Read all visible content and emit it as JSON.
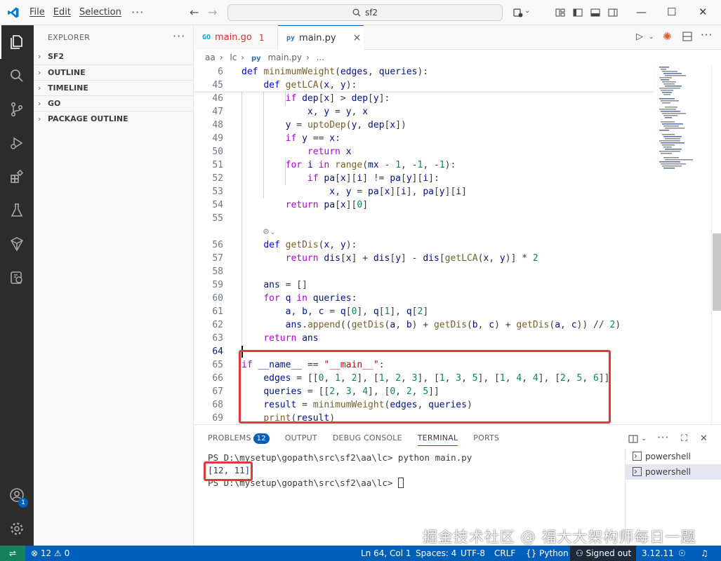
{
  "titlebar": {
    "menu": [
      "File",
      "Edit",
      "Selection"
    ],
    "more": "···",
    "search_text": "sf2"
  },
  "sidebar": {
    "title": "EXPLORER",
    "more": "···",
    "sections": [
      "SF2",
      "OUTLINE",
      "TIMELINE",
      "GO",
      "PACKAGE OUTLINE"
    ]
  },
  "tabs": [
    {
      "label": "main.go",
      "icon": "GO",
      "problems": "1"
    },
    {
      "label": "main.py",
      "icon": "py",
      "close": "×"
    }
  ],
  "breadcrumb": [
    "aa",
    "lc",
    "main.py"
  ],
  "editor": {
    "sticky": [
      {
        "num": "6",
        "tokens": [
          [
            "kw",
            "def "
          ],
          [
            "fn",
            "minimumWeight"
          ],
          [
            "",
            "("
          ],
          [
            "var",
            "edges"
          ],
          [
            "",
            ", "
          ],
          [
            "var",
            "queries"
          ],
          [
            "",
            "):"
          ]
        ]
      },
      {
        "num": "45",
        "tokens": [
          [
            "",
            "    "
          ],
          [
            "kw",
            "def "
          ],
          [
            "fn",
            "getLCA"
          ],
          [
            "",
            "("
          ],
          [
            "var",
            "x"
          ],
          [
            "",
            ", "
          ],
          [
            "var",
            "y"
          ],
          [
            "",
            "):"
          ]
        ]
      }
    ],
    "lines": [
      {
        "num": "46",
        "tokens": [
          [
            "",
            "        "
          ],
          [
            "kw2",
            "if "
          ],
          [
            "var",
            "dep"
          ],
          [
            "",
            "["
          ],
          [
            "var",
            "x"
          ],
          [
            "",
            "] > "
          ],
          [
            "var",
            "dep"
          ],
          [
            "",
            "["
          ],
          [
            "var",
            "y"
          ],
          [
            "",
            "]:"
          ]
        ]
      },
      {
        "num": "47",
        "tokens": [
          [
            "",
            "            "
          ],
          [
            "var",
            "x"
          ],
          [
            "",
            ", "
          ],
          [
            "var",
            "y"
          ],
          [
            "",
            " = "
          ],
          [
            "var",
            "y"
          ],
          [
            "",
            ", "
          ],
          [
            "var",
            "x"
          ]
        ]
      },
      {
        "num": "48",
        "tokens": [
          [
            "",
            "        "
          ],
          [
            "var",
            "y"
          ],
          [
            "",
            " = "
          ],
          [
            "fn",
            "uptoDep"
          ],
          [
            "",
            "("
          ],
          [
            "var",
            "y"
          ],
          [
            "",
            ", "
          ],
          [
            "var",
            "dep"
          ],
          [
            "",
            "["
          ],
          [
            "var",
            "x"
          ],
          [
            "",
            "])"
          ]
        ]
      },
      {
        "num": "49",
        "tokens": [
          [
            "",
            "        "
          ],
          [
            "kw2",
            "if "
          ],
          [
            "var",
            "y"
          ],
          [
            "",
            " == "
          ],
          [
            "var",
            "x"
          ],
          [
            "",
            ":"
          ]
        ]
      },
      {
        "num": "50",
        "tokens": [
          [
            "",
            "            "
          ],
          [
            "kw2",
            "return "
          ],
          [
            "var",
            "x"
          ]
        ]
      },
      {
        "num": "51",
        "tokens": [
          [
            "",
            "        "
          ],
          [
            "kw2",
            "for "
          ],
          [
            "var",
            "i"
          ],
          [
            "kw2",
            " in "
          ],
          [
            "fn",
            "range"
          ],
          [
            "",
            "("
          ],
          [
            "var",
            "mx"
          ],
          [
            "",
            " - "
          ],
          [
            "num",
            "1"
          ],
          [
            "",
            ", -"
          ],
          [
            "num",
            "1"
          ],
          [
            "",
            ", -"
          ],
          [
            "num",
            "1"
          ],
          [
            "",
            "):"
          ]
        ]
      },
      {
        "num": "52",
        "tokens": [
          [
            "",
            "            "
          ],
          [
            "kw2",
            "if "
          ],
          [
            "var",
            "pa"
          ],
          [
            "",
            "["
          ],
          [
            "var",
            "x"
          ],
          [
            "",
            "]["
          ],
          [
            "var",
            "i"
          ],
          [
            "",
            "] != "
          ],
          [
            "var",
            "pa"
          ],
          [
            "",
            "["
          ],
          [
            "var",
            "y"
          ],
          [
            "",
            "]["
          ],
          [
            "var",
            "i"
          ],
          [
            "",
            "]:"
          ]
        ]
      },
      {
        "num": "53",
        "tokens": [
          [
            "",
            "                "
          ],
          [
            "var",
            "x"
          ],
          [
            "",
            ", "
          ],
          [
            "var",
            "y"
          ],
          [
            "",
            " = "
          ],
          [
            "var",
            "pa"
          ],
          [
            "",
            "["
          ],
          [
            "var",
            "x"
          ],
          [
            "",
            "]["
          ],
          [
            "var",
            "i"
          ],
          [
            "",
            "], "
          ],
          [
            "var",
            "pa"
          ],
          [
            "",
            "["
          ],
          [
            "var",
            "y"
          ],
          [
            "",
            "]["
          ],
          [
            "var",
            "i"
          ],
          [
            "",
            "]"
          ]
        ]
      },
      {
        "num": "54",
        "tokens": [
          [
            "",
            "        "
          ],
          [
            "kw2",
            "return "
          ],
          [
            "var",
            "pa"
          ],
          [
            "",
            "["
          ],
          [
            "var",
            "x"
          ],
          [
            "",
            "]["
          ],
          [
            "num",
            "0"
          ],
          [
            "",
            "]"
          ]
        ]
      },
      {
        "num": "55",
        "tokens": []
      },
      {
        "num": "56",
        "tokens": [
          [
            "",
            "    "
          ],
          [
            "kw",
            "def "
          ],
          [
            "fn",
            "getDis"
          ],
          [
            "",
            "("
          ],
          [
            "var",
            "x"
          ],
          [
            "",
            ", "
          ],
          [
            "var",
            "y"
          ],
          [
            "",
            "):"
          ]
        ]
      },
      {
        "num": "57",
        "tokens": [
          [
            "",
            "        "
          ],
          [
            "kw2",
            "return "
          ],
          [
            "var",
            "dis"
          ],
          [
            "",
            "["
          ],
          [
            "var",
            "x"
          ],
          [
            "",
            "] + "
          ],
          [
            "var",
            "dis"
          ],
          [
            "",
            "["
          ],
          [
            "var",
            "y"
          ],
          [
            "",
            "] - "
          ],
          [
            "var",
            "dis"
          ],
          [
            "",
            "["
          ],
          [
            "fn",
            "getLCA"
          ],
          [
            "",
            "("
          ],
          [
            "var",
            "x"
          ],
          [
            "",
            ", "
          ],
          [
            "var",
            "y"
          ],
          [
            "",
            ")] * "
          ],
          [
            "num",
            "2"
          ]
        ]
      },
      {
        "num": "58",
        "tokens": []
      },
      {
        "num": "59",
        "tokens": [
          [
            "",
            "    "
          ],
          [
            "var",
            "ans"
          ],
          [
            "",
            " = []"
          ]
        ]
      },
      {
        "num": "60",
        "tokens": [
          [
            "",
            "    "
          ],
          [
            "kw2",
            "for "
          ],
          [
            "var",
            "q"
          ],
          [
            "kw2",
            " in "
          ],
          [
            "var",
            "queries"
          ],
          [
            "",
            ":"
          ]
        ]
      },
      {
        "num": "61",
        "tokens": [
          [
            "",
            "        "
          ],
          [
            "var",
            "a"
          ],
          [
            "",
            ", "
          ],
          [
            "var",
            "b"
          ],
          [
            "",
            ", "
          ],
          [
            "var",
            "c"
          ],
          [
            "",
            " = "
          ],
          [
            "var",
            "q"
          ],
          [
            "",
            "["
          ],
          [
            "num",
            "0"
          ],
          [
            "",
            "], "
          ],
          [
            "var",
            "q"
          ],
          [
            "",
            "["
          ],
          [
            "num",
            "1"
          ],
          [
            "",
            "], "
          ],
          [
            "var",
            "q"
          ],
          [
            "",
            "["
          ],
          [
            "num",
            "2"
          ],
          [
            "",
            "]"
          ]
        ]
      },
      {
        "num": "62",
        "tokens": [
          [
            "",
            "        "
          ],
          [
            "var",
            "ans"
          ],
          [
            "",
            "."
          ],
          [
            "fn",
            "append"
          ],
          [
            "",
            "(("
          ],
          [
            "fn",
            "getDis"
          ],
          [
            "",
            "("
          ],
          [
            "var",
            "a"
          ],
          [
            "",
            ", "
          ],
          [
            "var",
            "b"
          ],
          [
            "",
            ") + "
          ],
          [
            "fn",
            "getDis"
          ],
          [
            "",
            "("
          ],
          [
            "var",
            "b"
          ],
          [
            "",
            ", "
          ],
          [
            "var",
            "c"
          ],
          [
            "",
            ") + "
          ],
          [
            "fn",
            "getDis"
          ],
          [
            "",
            "("
          ],
          [
            "var",
            "a"
          ],
          [
            "",
            ", "
          ],
          [
            "var",
            "c"
          ],
          [
            "",
            "))"
          ],
          [
            "",
            " // "
          ],
          [
            "num",
            "2"
          ],
          [
            "",
            ")"
          ]
        ]
      },
      {
        "num": "63",
        "tokens": [
          [
            "",
            "    "
          ],
          [
            "kw2",
            "return "
          ],
          [
            "var",
            "ans"
          ]
        ]
      },
      {
        "num": "64",
        "tokens": []
      },
      {
        "num": "65",
        "tokens": [
          [
            "kw2",
            "if "
          ],
          [
            "var",
            "__name__"
          ],
          [
            "",
            " == "
          ],
          [
            "str",
            "\"__main__\""
          ],
          [
            "",
            ":"
          ]
        ]
      },
      {
        "num": "66",
        "tokens": [
          [
            "",
            "    "
          ],
          [
            "var",
            "edges"
          ],
          [
            "",
            " = [["
          ],
          [
            "num",
            "0"
          ],
          [
            "",
            ", "
          ],
          [
            "num",
            "1"
          ],
          [
            "",
            ", "
          ],
          [
            "num",
            "2"
          ],
          [
            "",
            "], ["
          ],
          [
            "num",
            "1"
          ],
          [
            "",
            ", "
          ],
          [
            "num",
            "2"
          ],
          [
            "",
            ", "
          ],
          [
            "num",
            "3"
          ],
          [
            "",
            "], ["
          ],
          [
            "num",
            "1"
          ],
          [
            "",
            ", "
          ],
          [
            "num",
            "3"
          ],
          [
            "",
            ", "
          ],
          [
            "num",
            "5"
          ],
          [
            "",
            "], ["
          ],
          [
            "num",
            "1"
          ],
          [
            "",
            ", "
          ],
          [
            "num",
            "4"
          ],
          [
            "",
            ", "
          ],
          [
            "num",
            "4"
          ],
          [
            "",
            "], ["
          ],
          [
            "num",
            "2"
          ],
          [
            "",
            ", "
          ],
          [
            "num",
            "5"
          ],
          [
            "",
            ", "
          ],
          [
            "num",
            "6"
          ],
          [
            "",
            "]]"
          ]
        ]
      },
      {
        "num": "67",
        "tokens": [
          [
            "",
            "    "
          ],
          [
            "var",
            "queries"
          ],
          [
            "",
            " = [["
          ],
          [
            "num",
            "2"
          ],
          [
            "",
            ", "
          ],
          [
            "num",
            "3"
          ],
          [
            "",
            ", "
          ],
          [
            "num",
            "4"
          ],
          [
            "",
            "], ["
          ],
          [
            "num",
            "0"
          ],
          [
            "",
            ", "
          ],
          [
            "num",
            "2"
          ],
          [
            "",
            ", "
          ],
          [
            "num",
            "5"
          ],
          [
            "",
            "]]"
          ]
        ]
      },
      {
        "num": "68",
        "tokens": [
          [
            "",
            "    "
          ],
          [
            "var",
            "result"
          ],
          [
            "",
            " = "
          ],
          [
            "fn",
            "minimumWeight"
          ],
          [
            "",
            "("
          ],
          [
            "var",
            "edges"
          ],
          [
            "",
            ", "
          ],
          [
            "var",
            "queries"
          ],
          [
            "",
            ")"
          ]
        ]
      },
      {
        "num": "69",
        "tokens": [
          [
            "",
            "    "
          ],
          [
            "fn",
            "print"
          ],
          [
            "",
            "("
          ],
          [
            "var",
            "result"
          ],
          [
            "",
            ")"
          ]
        ]
      }
    ]
  },
  "panel": {
    "tabs": [
      "PROBLEMS",
      "OUTPUT",
      "DEBUG CONSOLE",
      "TERMINAL",
      "PORTS"
    ],
    "problems_count": "12",
    "terminal_lines": [
      "PS D:\\mysetup\\gopath\\src\\sf2\\aa\\lc> python main.py",
      "[12, 11]",
      "PS D:\\mysetup\\gopath\\src\\sf2\\aa\\lc> "
    ],
    "terminals": [
      "powershell",
      "powershell"
    ]
  },
  "watermark": "掘金技术社区 @ 福大大架构师每日一题",
  "statusbar": {
    "errors": "12",
    "warnings": "0",
    "position": "Ln 64, Col 1",
    "spaces": "Spaces: 4",
    "encoding": "UTF-8",
    "eol": "CRLF",
    "language": "Python",
    "account": "Signed out",
    "python_version": "3.12.11"
  },
  "colors": {
    "accent": "#005fb8",
    "highlight_box": "#e0383b",
    "activity_bar": "#2c2c2c",
    "remote": "#16825d"
  }
}
